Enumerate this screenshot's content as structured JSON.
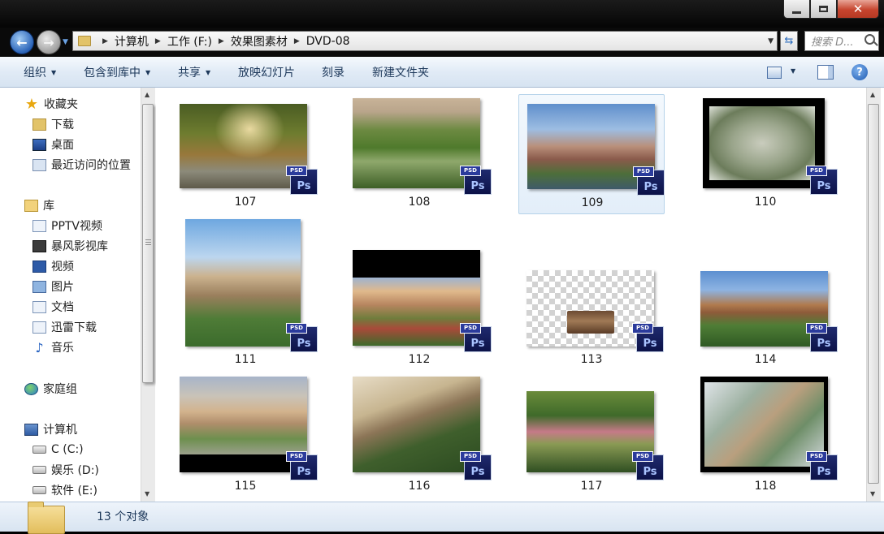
{
  "window": {
    "close_glyph": "✕"
  },
  "address": {
    "breadcrumbs": [
      "计算机",
      "工作 (F:)",
      "效果图素材",
      "DVD-08"
    ],
    "search_placeholder": "搜索 D..."
  },
  "toolbar": {
    "organize": "组织",
    "include_library": "包含到库中",
    "share": "共享",
    "slideshow": "放映幻灯片",
    "burn": "刻录",
    "new_folder": "新建文件夹"
  },
  "sidebar": {
    "favorites": {
      "title": "收藏夹",
      "items": [
        "下载",
        "桌面",
        "最近访问的位置"
      ]
    },
    "libraries": {
      "title": "库",
      "items": [
        "PPTV视频",
        "暴风影视库",
        "视频",
        "图片",
        "文档",
        "迅雷下载",
        "音乐"
      ]
    },
    "homegroup": "家庭组",
    "computer": {
      "title": "计算机",
      "items": [
        "C (C:)",
        "娱乐 (D:)",
        "软件 (E:)"
      ]
    }
  },
  "files": [
    {
      "name": "107",
      "badge": "PSD",
      "app": "Ps"
    },
    {
      "name": "108",
      "badge": "PSD",
      "app": "Ps"
    },
    {
      "name": "109",
      "badge": "PSD",
      "app": "Ps",
      "selected": true
    },
    {
      "name": "110",
      "badge": "PSD",
      "app": "Ps"
    },
    {
      "name": "111",
      "badge": "PSD",
      "app": "Ps"
    },
    {
      "name": "112",
      "badge": "PSD",
      "app": "Ps"
    },
    {
      "name": "113",
      "badge": "PSD",
      "app": "Ps"
    },
    {
      "name": "114",
      "badge": "PSD",
      "app": "Ps"
    },
    {
      "name": "115",
      "badge": "PSD",
      "app": "Ps"
    },
    {
      "name": "116",
      "badge": "PSD",
      "app": "Ps"
    },
    {
      "name": "117",
      "badge": "PSD",
      "app": "Ps"
    },
    {
      "name": "118",
      "badge": "PSD",
      "app": "Ps"
    }
  ],
  "status": {
    "count_text": "13 个对象"
  },
  "colors": {
    "command_bar_text": "#1e395b",
    "selection_border": "#b5d2ea",
    "close_button": "#c6442e"
  }
}
